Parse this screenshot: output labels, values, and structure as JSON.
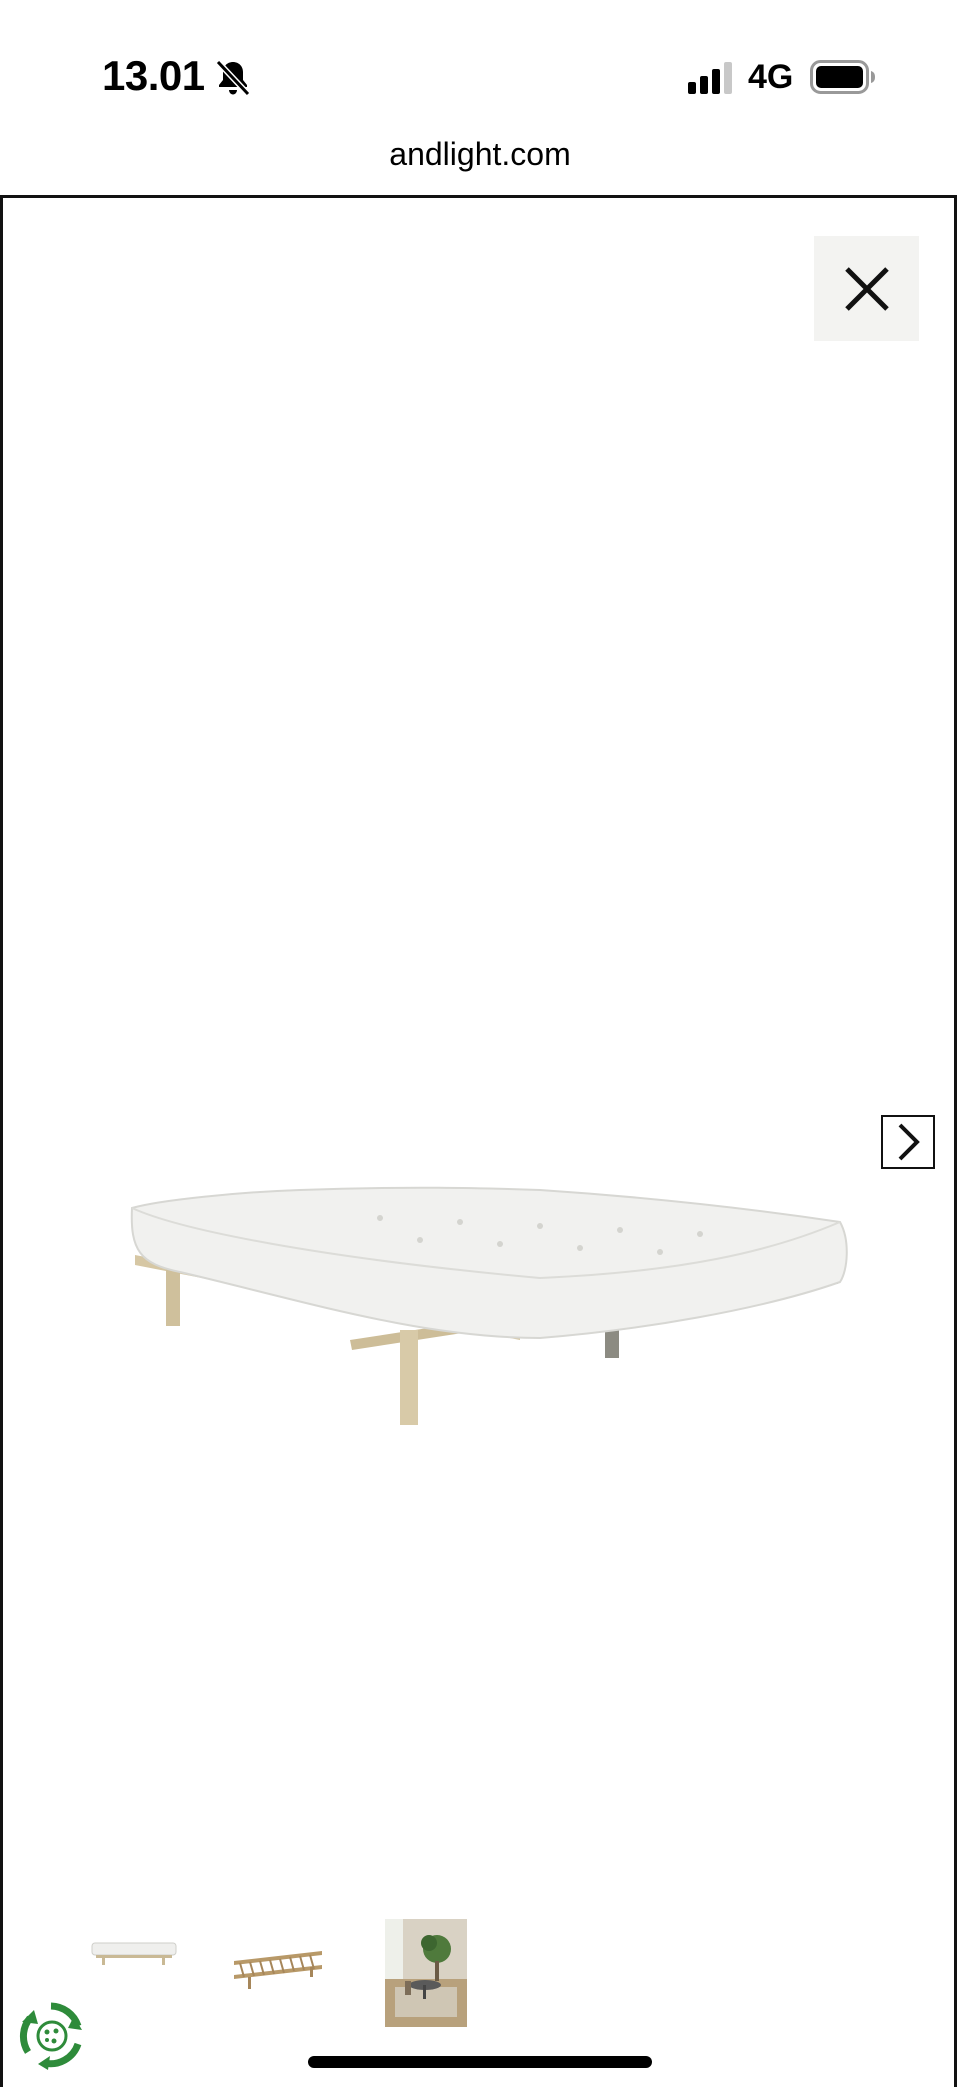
{
  "status_bar": {
    "time": "13.01",
    "mute_icon": "bell-slash-icon",
    "signal_icon": "cellular-signal-icon",
    "network": "4G",
    "battery_icon": "battery-icon"
  },
  "browser": {
    "url": "andlight.com"
  },
  "gallery": {
    "close_icon": "close-icon",
    "next_icon": "chevron-right-icon",
    "main_image": "bed-with-mattress-image",
    "thumbnails": [
      {
        "name": "thumbnail-bed-mattress"
      },
      {
        "name": "thumbnail-bed-frame"
      },
      {
        "name": "thumbnail-room-scene"
      }
    ]
  },
  "colors": {
    "close_bg": "#f3f3f1",
    "border": "#111111",
    "eco_green": "#2e8b3a"
  }
}
